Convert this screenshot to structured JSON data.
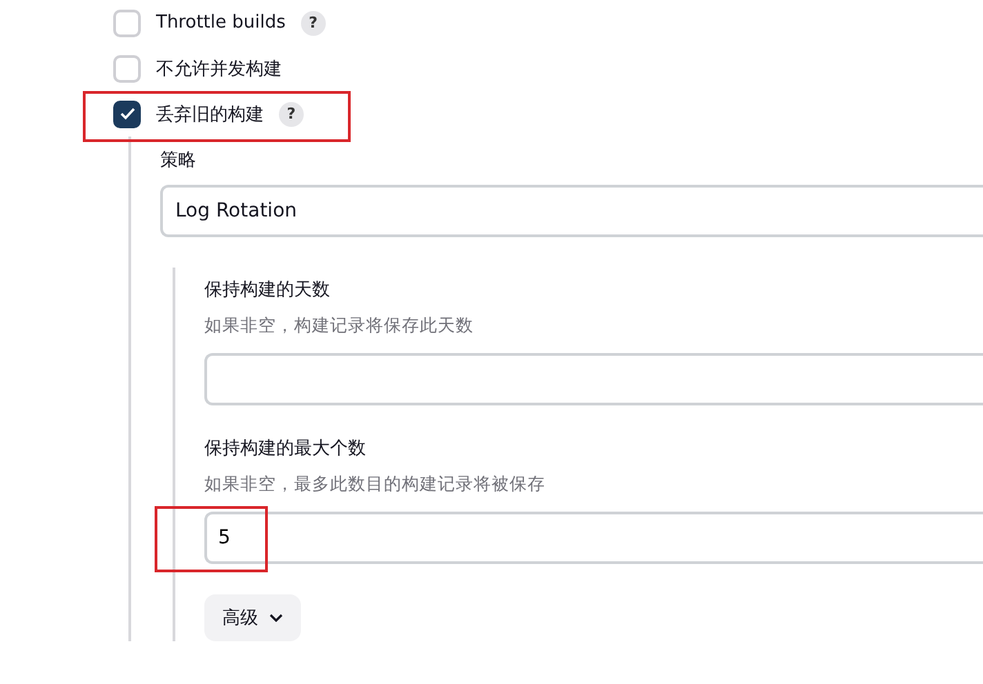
{
  "options": [
    {
      "label": "Throttle builds",
      "checked": false,
      "help": "?",
      "highlighted": false
    },
    {
      "label": "不允许并发构建",
      "checked": false,
      "highlighted": false
    },
    {
      "label": "丢弃旧的构建",
      "checked": true,
      "help": "?",
      "highlighted": true
    }
  ],
  "strategy": {
    "label": "策略",
    "value": "Log Rotation"
  },
  "fields": [
    {
      "label": "保持构建的天数",
      "hint": "如果非空，构建记录将保存此天数",
      "highlighted": false
    },
    {
      "label": "保持构建的最大个数",
      "hint": "如果非空，最多此数目的构建记录将被保存",
      "value": "5",
      "highlighted": true
    }
  ],
  "advanced_button": {
    "label": "高级",
    "expanded": false
  }
}
